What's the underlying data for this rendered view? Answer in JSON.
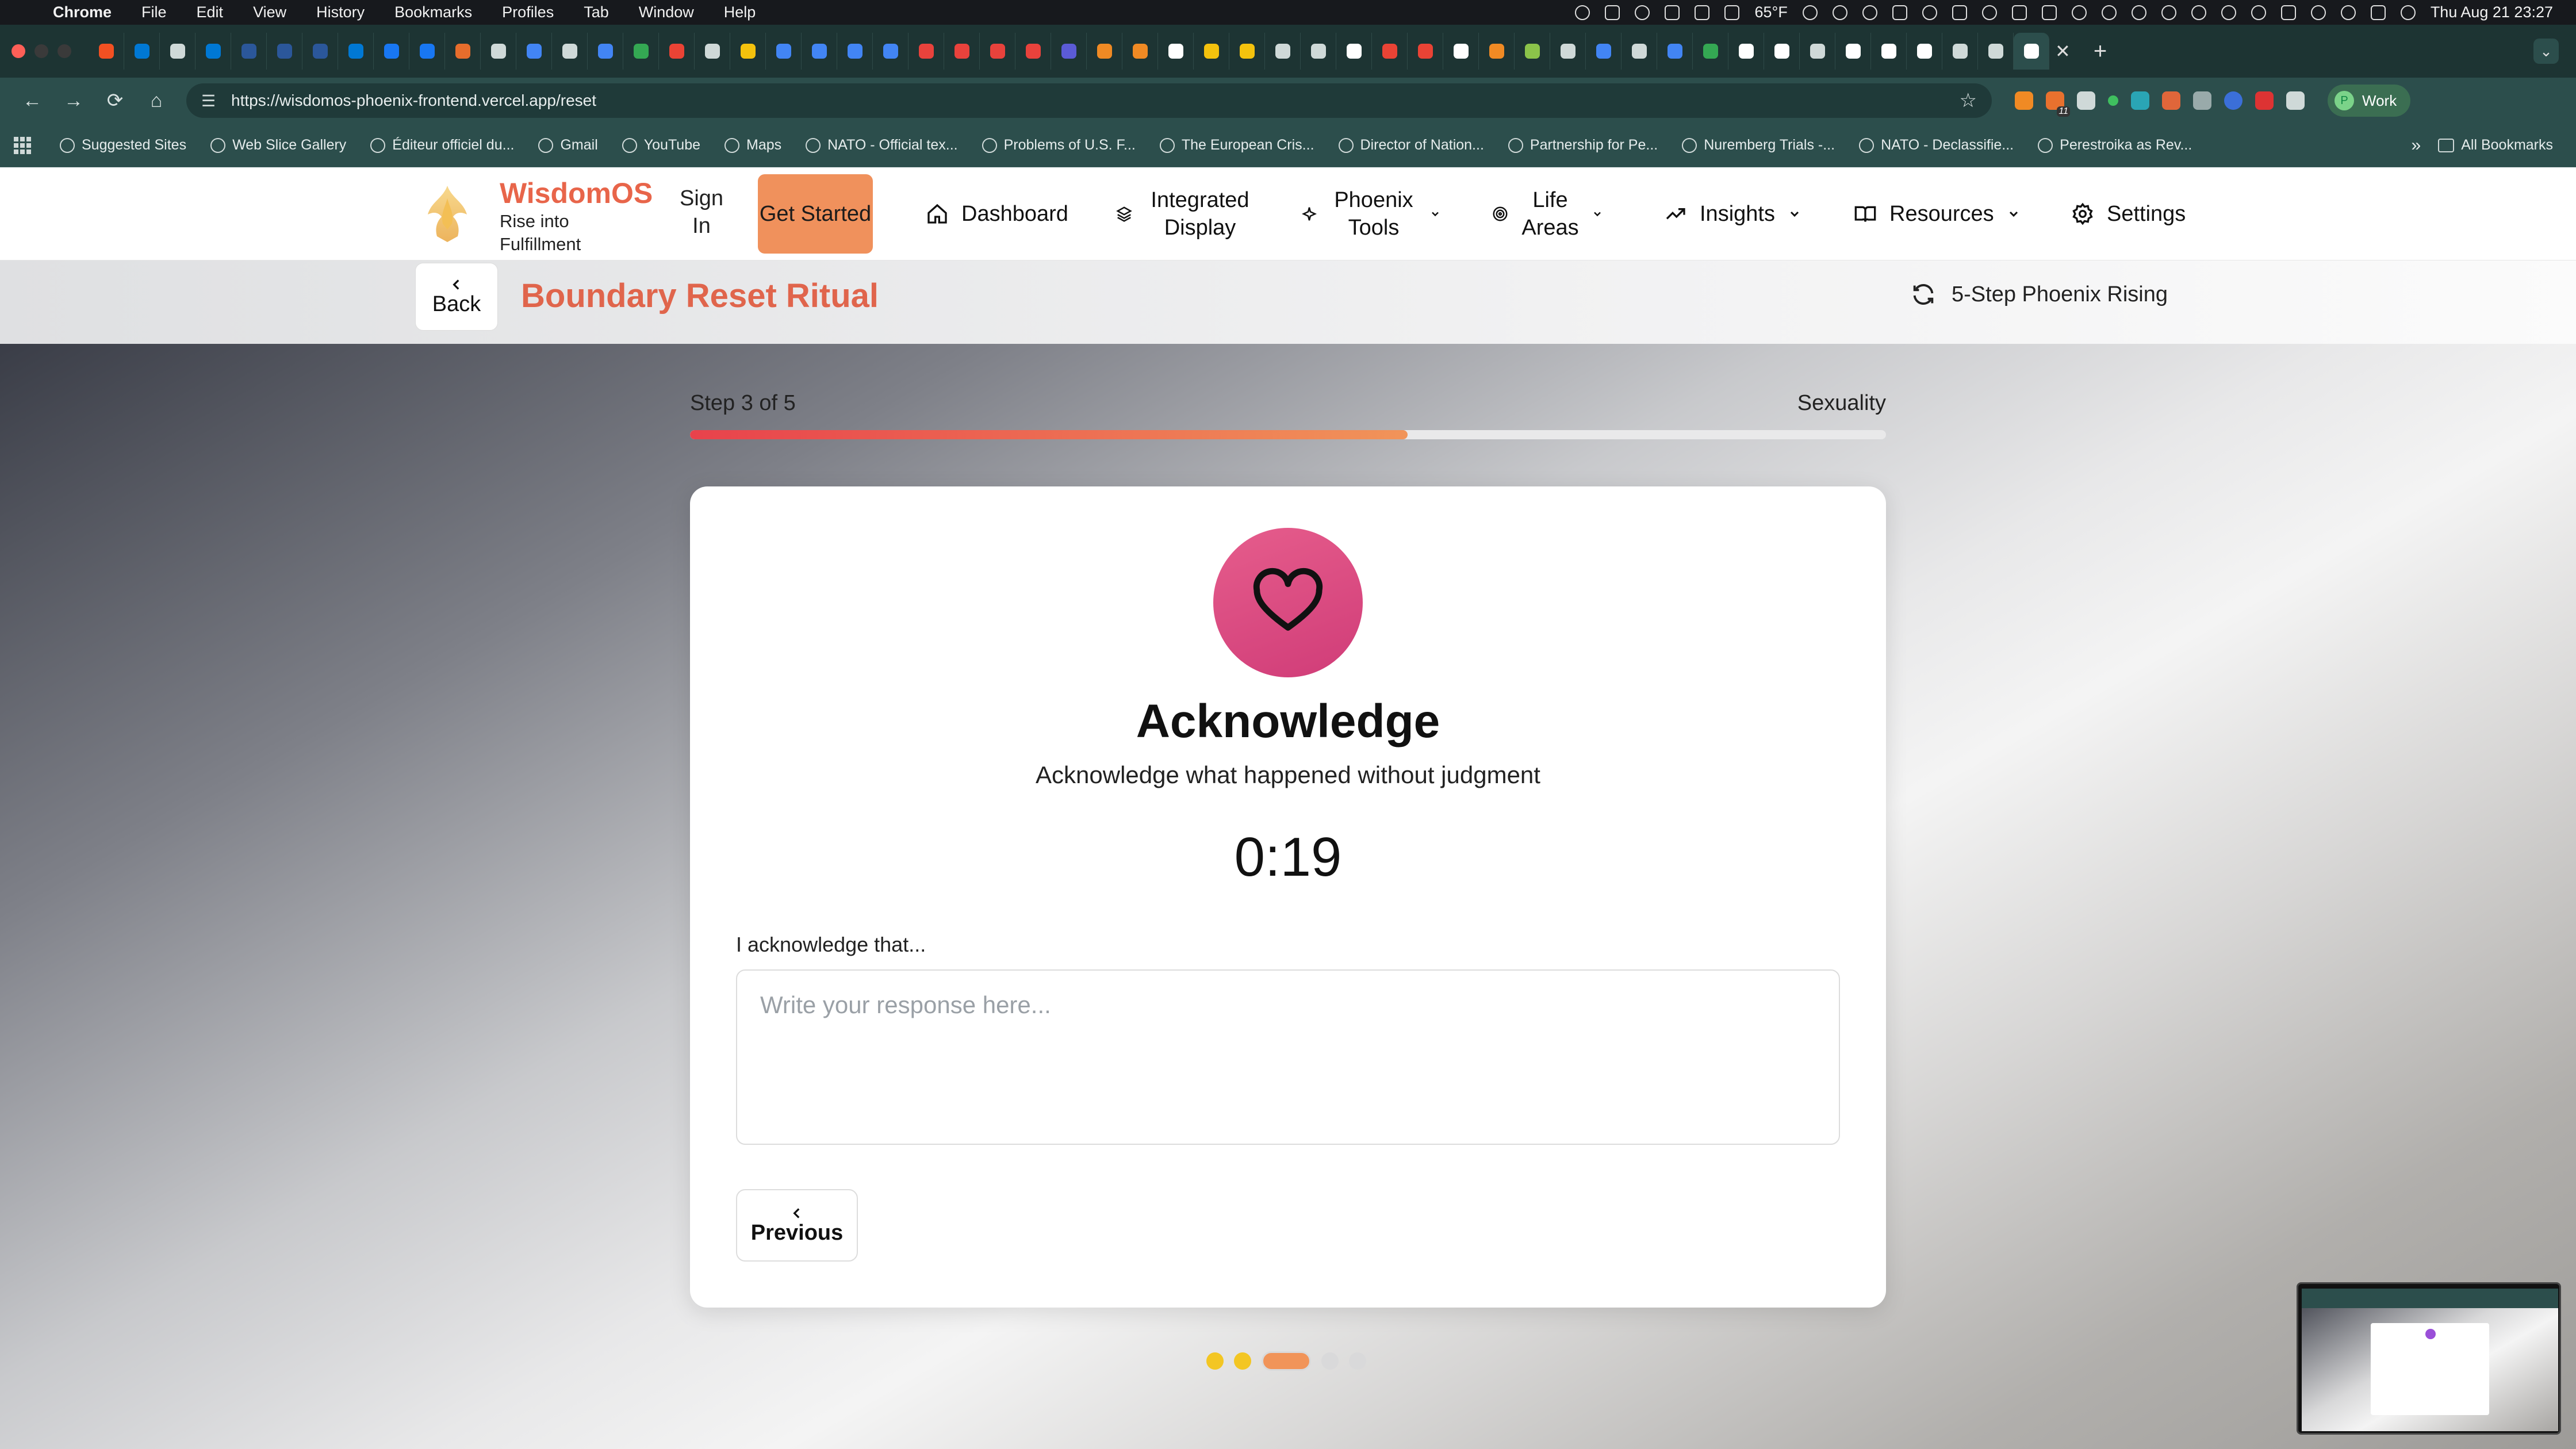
{
  "os_menubar": {
    "app_name": "Chrome",
    "menus": [
      "File",
      "Edit",
      "View",
      "History",
      "Bookmarks",
      "Profiles",
      "Tab",
      "Window",
      "Help"
    ],
    "weather": "65°F",
    "datetime": "Thu Aug 21  23:27"
  },
  "browser": {
    "url": "https://wisdomos-phoenix-frontend.vercel.app/reset",
    "profile_label": "Work",
    "profile_initial": "P",
    "extension_badge": "11",
    "bookmarks": [
      "Suggested Sites",
      "Web Slice Gallery",
      "Éditeur officiel du...",
      "Gmail",
      "YouTube",
      "Maps",
      "NATO - Official tex...",
      "Problems of U.S. F...",
      "The European Cris...",
      "Director of Nation...",
      "Partnership for Pe...",
      "Nuremberg Trials -...",
      "NATO - Declassifie...",
      "Perestroika as Rev..."
    ],
    "all_bookmarks": "All Bookmarks"
  },
  "app": {
    "brand_name": "WisdomOS",
    "brand_tagline": "Rise into Fulfillment",
    "sign_in": "Sign In",
    "get_started": "Get Started",
    "nav": {
      "dashboard": "Dashboard",
      "integrated_display": "Integrated Display",
      "phoenix_tools": "Phoenix Tools",
      "life_areas": "Life Areas",
      "insights": "Insights",
      "resources": "Resources",
      "settings": "Settings"
    }
  },
  "subheader": {
    "back": "Back",
    "title": "Boundary Reset Ritual",
    "mode": "5-Step Phoenix Rising"
  },
  "step": {
    "progress_text": "Step 3 of 5",
    "category": "Sexuality",
    "progress_fraction": 0.6,
    "title": "Acknowledge",
    "description": "Acknowledge what happened without judgment",
    "timer": "0:19",
    "field_label": "I acknowledge that...",
    "field_value": "",
    "field_placeholder": "Write your response here...",
    "previous": "Previous"
  },
  "step_dots": [
    {
      "state": "complete",
      "color": "#f3c623"
    },
    {
      "state": "complete",
      "color": "#f3c623"
    },
    {
      "state": "current",
      "color": "#f19459"
    },
    {
      "state": "upcoming",
      "color": "#d9d9da"
    },
    {
      "state": "upcoming",
      "color": "#d9d9da"
    }
  ],
  "colors": {
    "brand": "#e8654a",
    "cta": "#f0915c",
    "progress_start": "#e8424c",
    "progress_end": "#f19459",
    "heart_bg": "#dc4a82"
  },
  "icons": {
    "heart": "heart-icon",
    "refresh": "refresh-icon",
    "home": "home-icon",
    "layers": "layers-icon",
    "sparkle": "sparkle-icon",
    "target": "target-icon",
    "trend": "trend-icon",
    "book": "book-icon",
    "gear": "gear-icon"
  }
}
